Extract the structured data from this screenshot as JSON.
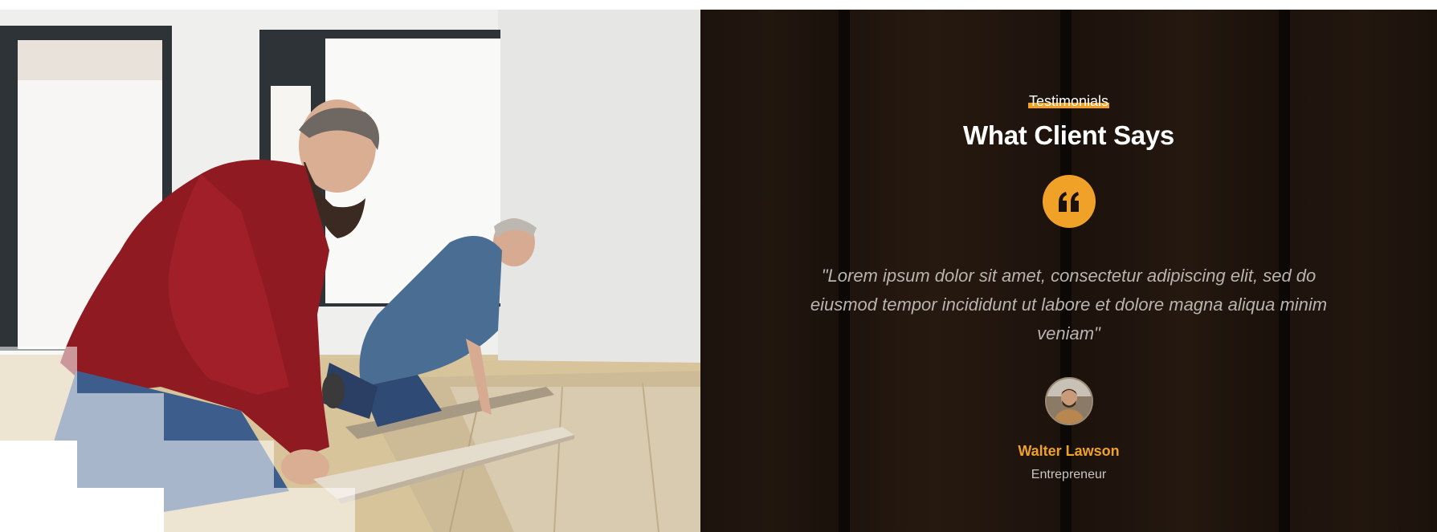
{
  "photo": {
    "icon": "workers-installing-floor-photo"
  },
  "testimonial": {
    "kicker": "Testimonials",
    "heading": "What Client Says",
    "quote_icon": "quote-icon",
    "quote": "\"Lorem ipsum dolor sit amet, consectetur adipiscing elit, sed do eiusmod tempor incididunt ut labore et dolore magna aliqua minim veniam\"",
    "avatar_icon": "client-avatar",
    "client_name": "Walter Lawson",
    "client_role": "Entrepreneur"
  },
  "colors": {
    "accent": "#f0a127",
    "panel_bg": "#1b110c",
    "quote_text": "#b9b3ae"
  }
}
